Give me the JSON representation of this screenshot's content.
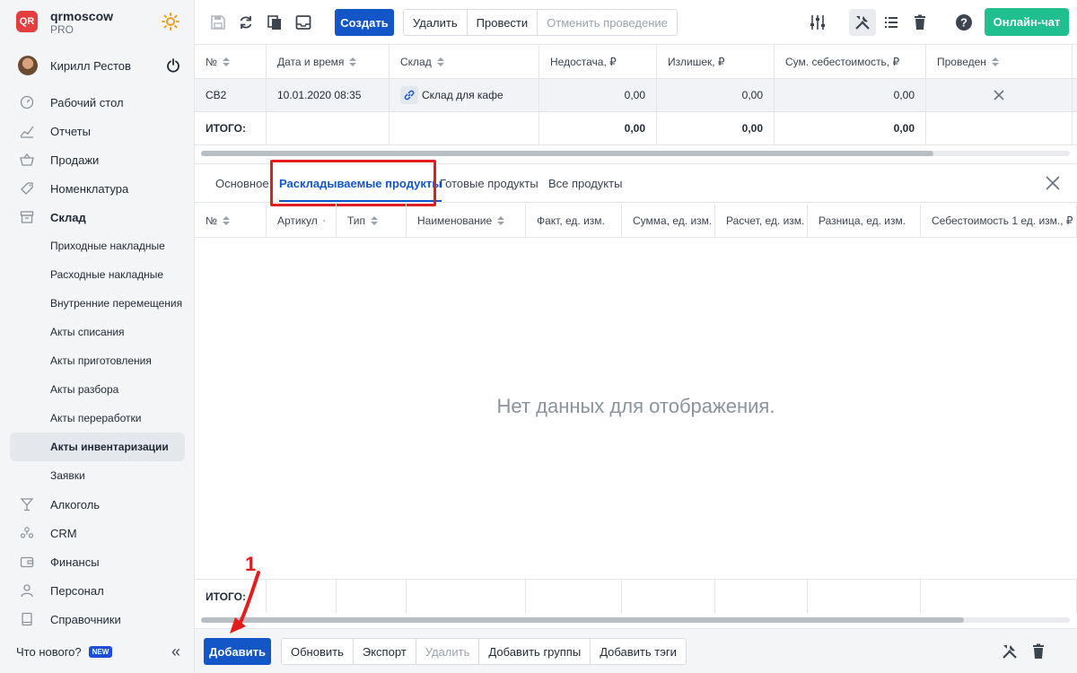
{
  "brand": {
    "name": "qrmoscow",
    "plan": "PRO",
    "logo_text": "QR"
  },
  "user": {
    "name": "Кирилл Рестов"
  },
  "nav": {
    "items": [
      {
        "label": "Рабочий стол",
        "icon": "dashboard-icon"
      },
      {
        "label": "Отчеты",
        "icon": "chart-icon"
      },
      {
        "label": "Продажи",
        "icon": "basket-icon"
      },
      {
        "label": "Номенклатура",
        "icon": "tag-icon"
      },
      {
        "label": "Склад",
        "icon": "box-icon"
      }
    ],
    "sub": [
      "Приходные накладные",
      "Расходные накладные",
      "Внутренние перемещения",
      "Акты списания",
      "Акты приготовления",
      "Акты разбора",
      "Акты переработки",
      "Акты инвентаризации",
      "Заявки"
    ],
    "items2": [
      {
        "label": "Алкоголь",
        "icon": "glass-icon"
      },
      {
        "label": "CRM",
        "icon": "people-icon"
      },
      {
        "label": "Финансы",
        "icon": "wallet-icon"
      },
      {
        "label": "Персонал",
        "icon": "person-icon"
      },
      {
        "label": "Справочники",
        "icon": "book-icon"
      }
    ]
  },
  "footer": {
    "whatsnew": "Что нового?",
    "badge": "NEW"
  },
  "toolbar": {
    "create": "Создать",
    "delete": "Удалить",
    "conduct": "Провести",
    "cancel_conduct": "Отменить проведение",
    "chat": "Онлайн-чат"
  },
  "top_table": {
    "headers": [
      "№",
      "Дата и время",
      "Склад",
      "Недостача, ₽",
      "Излишек, ₽",
      "Сум. себестоимость, ₽",
      "Проведен"
    ],
    "row": {
      "num": "СВ2",
      "date": "10.01.2020 08:35",
      "warehouse": "Склад для кафе",
      "shortage": "0,00",
      "surplus": "0,00",
      "cost": "0,00"
    },
    "total": {
      "label": "ИТОГО:",
      "shortage": "0,00",
      "surplus": "0,00",
      "cost": "0,00"
    }
  },
  "tabs": [
    "Основное",
    "Раскладываемые продукты",
    "Готовые продукты",
    "Все продукты"
  ],
  "inner_table": {
    "headers": [
      "№",
      "Артикул",
      "Тип",
      "Наименование",
      "Факт, ед. изм.",
      "Сумма, ед. изм.",
      "Расчет, ед. изм.",
      "Разница, ед. изм.",
      "Себестоимость 1 ед. изм., ₽"
    ],
    "empty": "Нет данных для отображения.",
    "total_label": "ИТОГО:"
  },
  "bottom": {
    "add": "Добавить",
    "refresh": "Обновить",
    "export": "Экспорт",
    "delete": "Удалить",
    "add_groups": "Добавить группы",
    "add_tags": "Добавить тэги"
  },
  "annotation": {
    "step": "1"
  },
  "colors": {
    "accent": "#1356c8",
    "chat": "#1fbf8f",
    "highlight": "#e11d1d"
  }
}
